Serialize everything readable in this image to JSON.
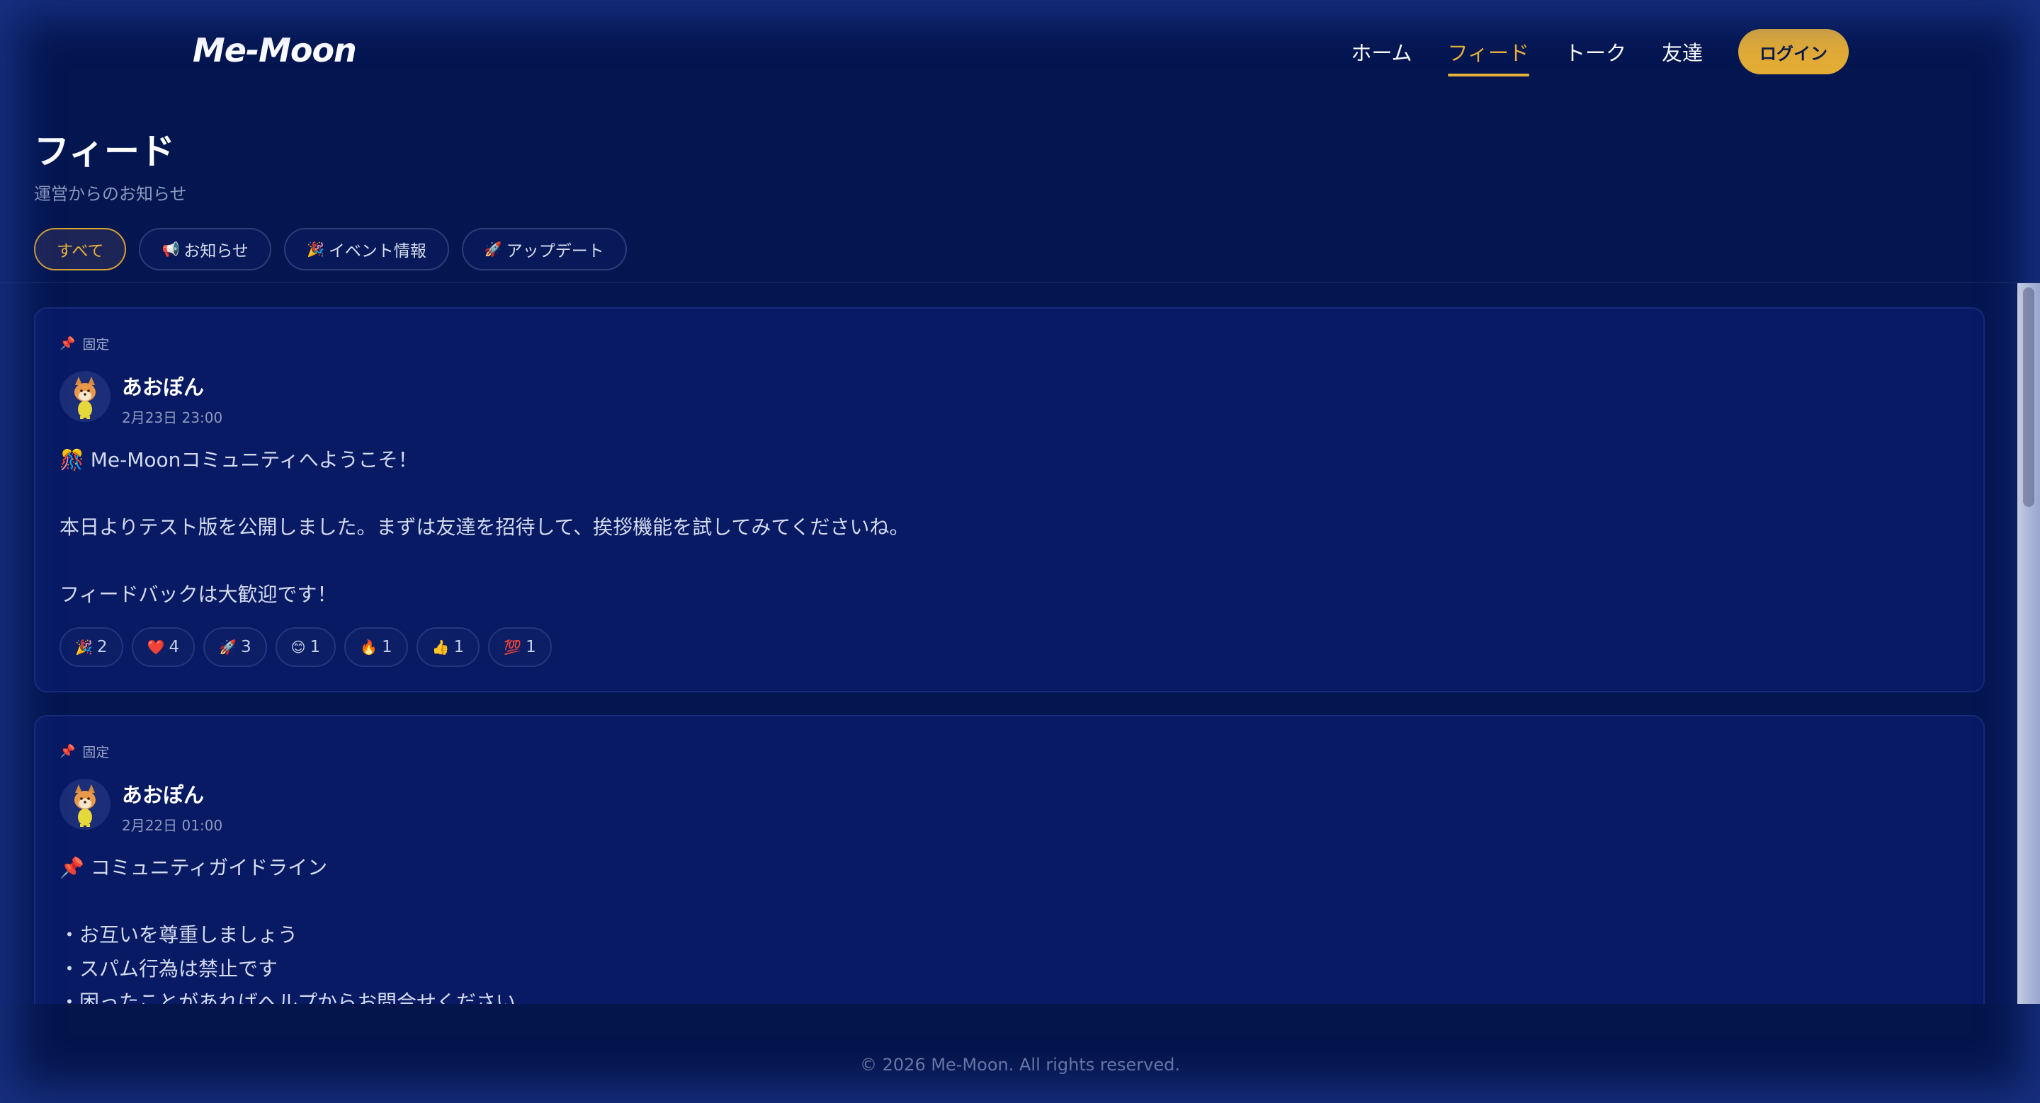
{
  "header": {
    "logo": "Me-Moon",
    "nav": [
      "ホーム",
      "フィード",
      "トーク",
      "友達"
    ],
    "active_nav": "フィード",
    "login_label": "ログイン"
  },
  "page": {
    "title": "フィード",
    "subtitle": "運営からのお知らせ"
  },
  "filters": [
    {
      "emoji": "",
      "label": "すべて",
      "active": true
    },
    {
      "emoji": "📢",
      "label": "お知らせ",
      "active": false
    },
    {
      "emoji": "🎉",
      "label": "イベント情報",
      "active": false
    },
    {
      "emoji": "🚀",
      "label": "アップデート",
      "active": false
    }
  ],
  "posts": [
    {
      "pinned_label": "固定",
      "author": "あおぽん",
      "time": "2月23日 23:00",
      "lines": [
        "🎊 Me-Moonコミュニティへようこそ！",
        "",
        "本日よりテスト版を公開しました。まずは友達を招待して、挨拶機能を試してみてくださいね。",
        "",
        "フィードバックは大歓迎です！"
      ],
      "reactions": [
        {
          "emoji": "🎉",
          "count": "2"
        },
        {
          "emoji": "❤️",
          "count": "4"
        },
        {
          "emoji": "🚀",
          "count": "3"
        },
        {
          "emoji": "😊",
          "count": "1"
        },
        {
          "emoji": "🔥",
          "count": "1"
        },
        {
          "emoji": "👍",
          "count": "1"
        },
        {
          "emoji": "💯",
          "count": "1"
        }
      ]
    },
    {
      "pinned_label": "固定",
      "author": "あおぽん",
      "time": "2月22日 01:00",
      "lines": [
        "📌 コミュニティガイドライン",
        "",
        "・お互いを尊重しましょう",
        "・スパム行為は禁止です",
        "・困ったことがあればヘルプからお問合せください"
      ],
      "reactions": []
    }
  ],
  "icons": {
    "pin": "pin-icon",
    "avatar": "shiba-dog-avatar"
  },
  "colors": {
    "background": "#041650",
    "card": "#081a64",
    "accent": "#e3ac35"
  },
  "footer": "© 2026 Me-Moon. All rights reserved."
}
